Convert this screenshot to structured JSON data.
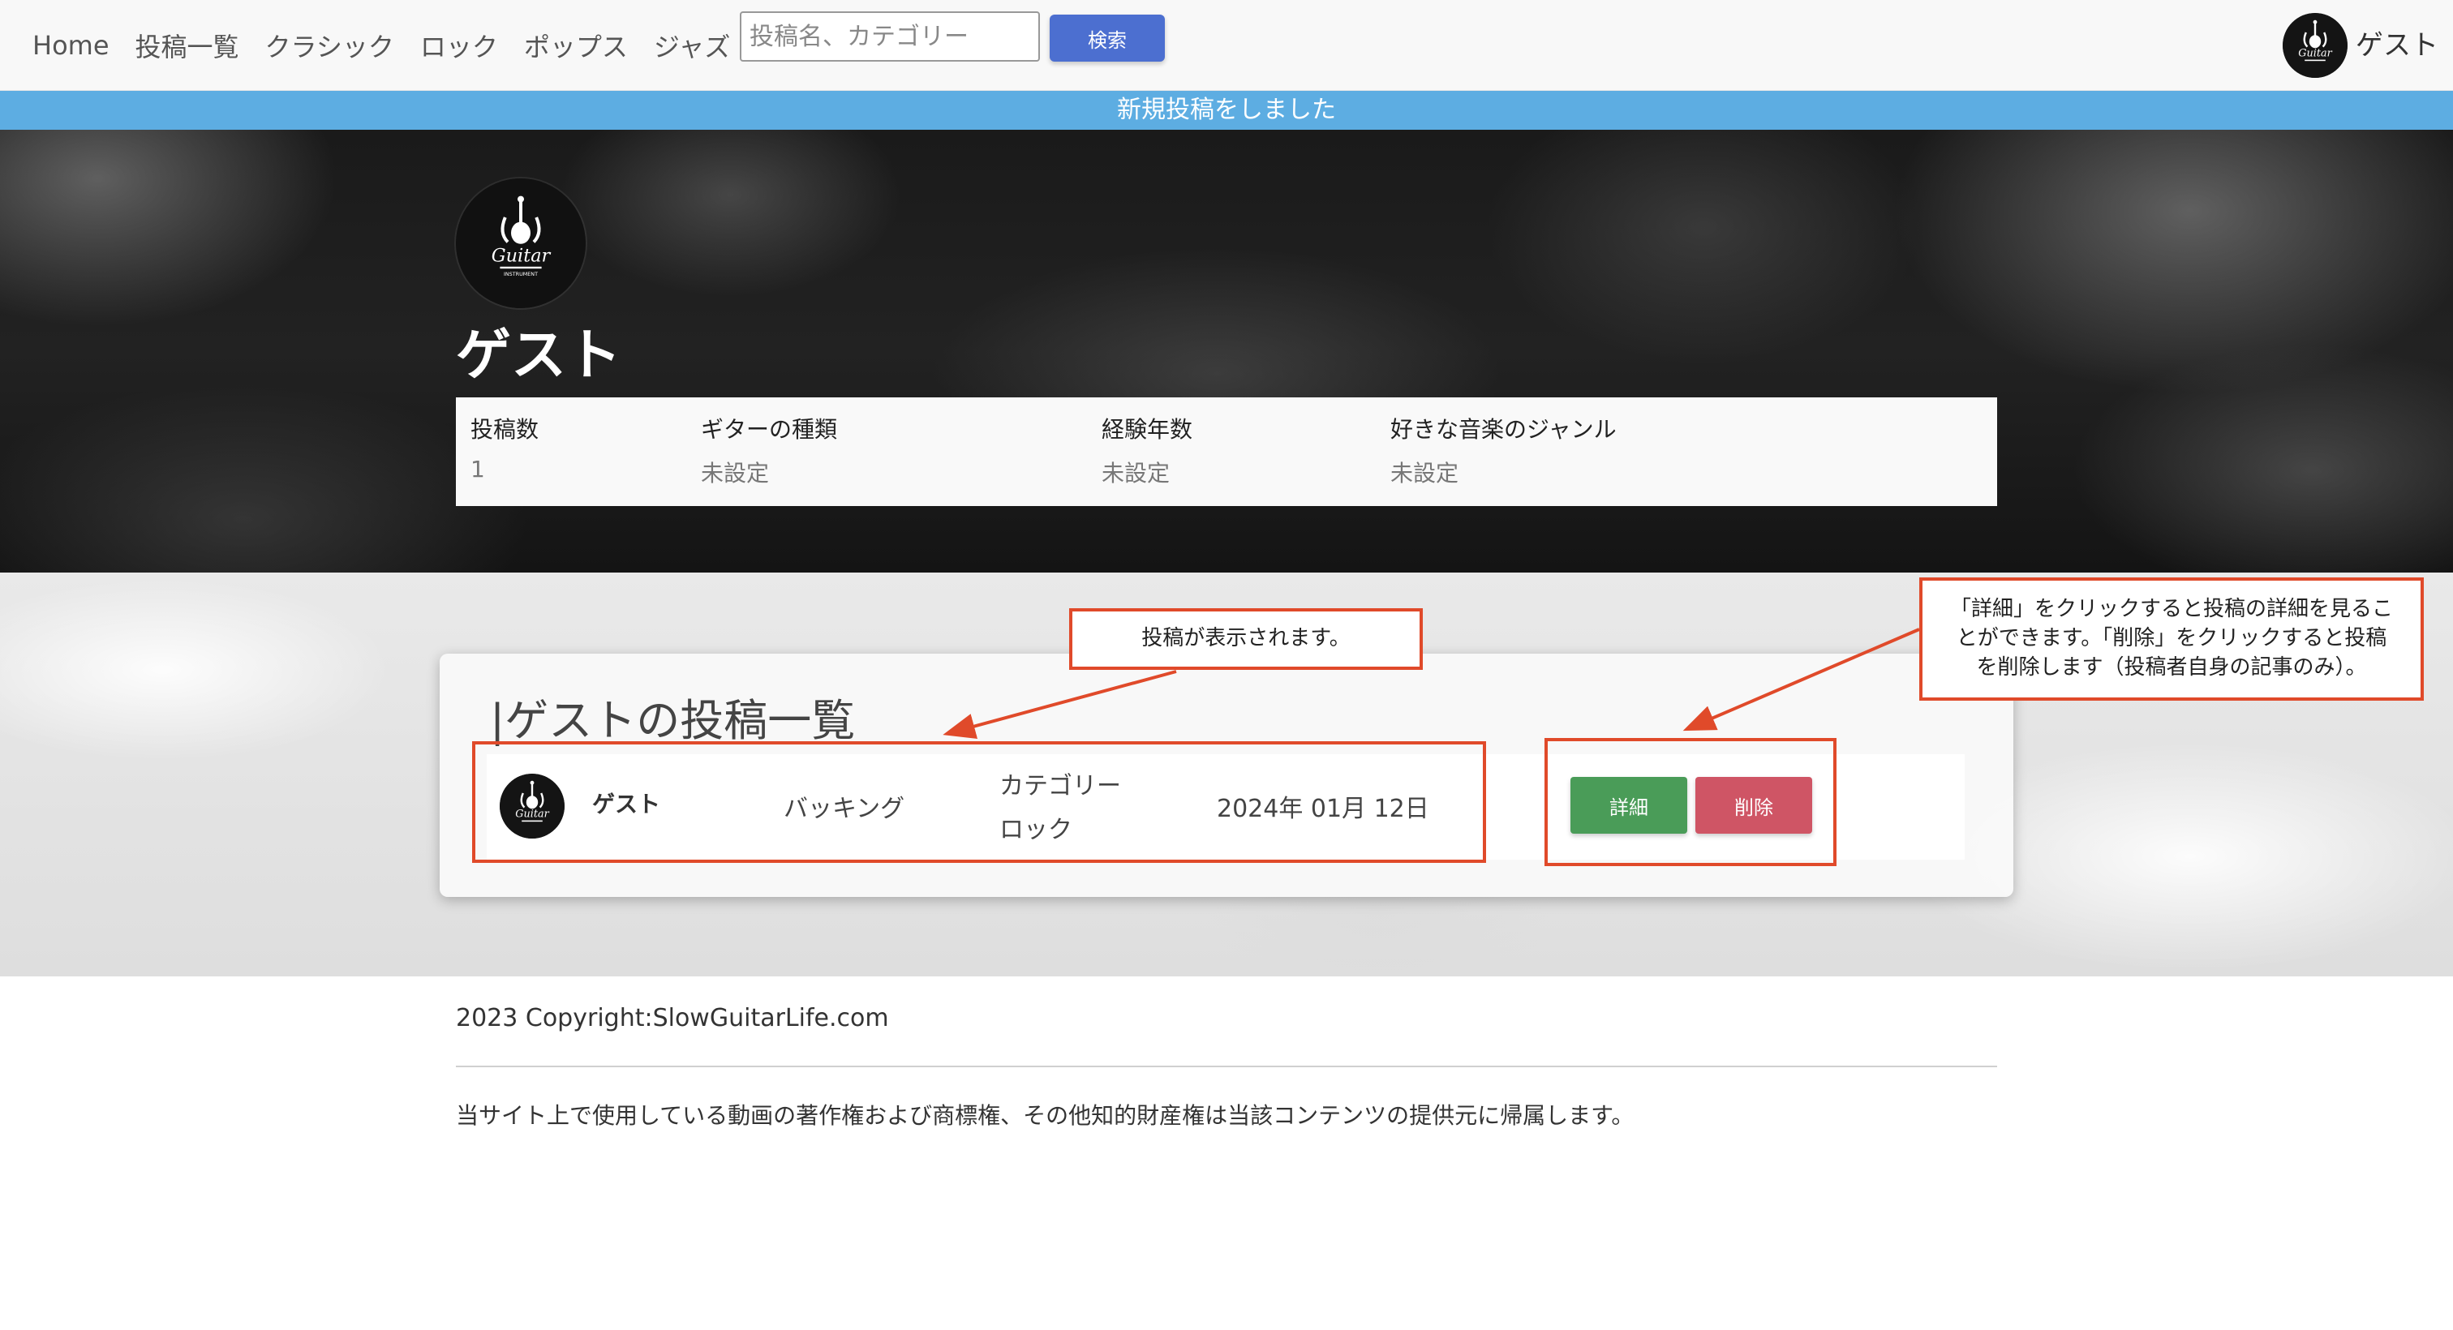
{
  "nav": {
    "links": [
      "Home",
      "投稿一覧",
      "クラシック",
      "ロック",
      "ポップス",
      "ジャズ"
    ],
    "search_placeholder": "投稿名、カテゴリー",
    "search_value": "",
    "search_button": "検索",
    "user_name": "ゲスト",
    "avatar_icon": "guitar-logo-icon"
  },
  "flash": {
    "message": "新規投稿をしました",
    "color": "#5dade2"
  },
  "profile": {
    "name": "ゲスト",
    "logo_text": "Guitar",
    "logo_subtext": "INSTRUMENT",
    "stats": [
      {
        "label": "投稿数",
        "value": "1"
      },
      {
        "label": "ギターの種類",
        "value": "未設定"
      },
      {
        "label": "経験年数",
        "value": "未設定"
      },
      {
        "label": "好きな音楽のジャンル",
        "value": "未設定"
      }
    ]
  },
  "posts": {
    "heading": "|ゲストの投稿一覧",
    "items": [
      {
        "user": "ゲスト",
        "title": "バッキング",
        "category_label": "カテゴリー",
        "category": "ロック",
        "date": "2024年 01月 12日",
        "detail_button": "詳細",
        "delete_button": "削除"
      }
    ]
  },
  "annotations": {
    "post_note": "投稿が表示されます。",
    "buttons_note_line1": "「詳細」をクリックすると投稿の詳細を見るこ",
    "buttons_note_line2": "とができます。「削除」をクリックすると投稿",
    "buttons_note_line3": "を削除します（投稿者自身の記事のみ）。",
    "color": "#e04a2a"
  },
  "footer": {
    "copyright": "2023 Copyright:SlowGuitarLife.com",
    "note": "当サイト上で使用している動画の著作権および商標権、その他知的財産権は当該コンテンツの提供元に帰属します。"
  },
  "colors": {
    "primary": "#4c6fd0",
    "detail": "#4a9c58",
    "delete": "#cf5565"
  }
}
